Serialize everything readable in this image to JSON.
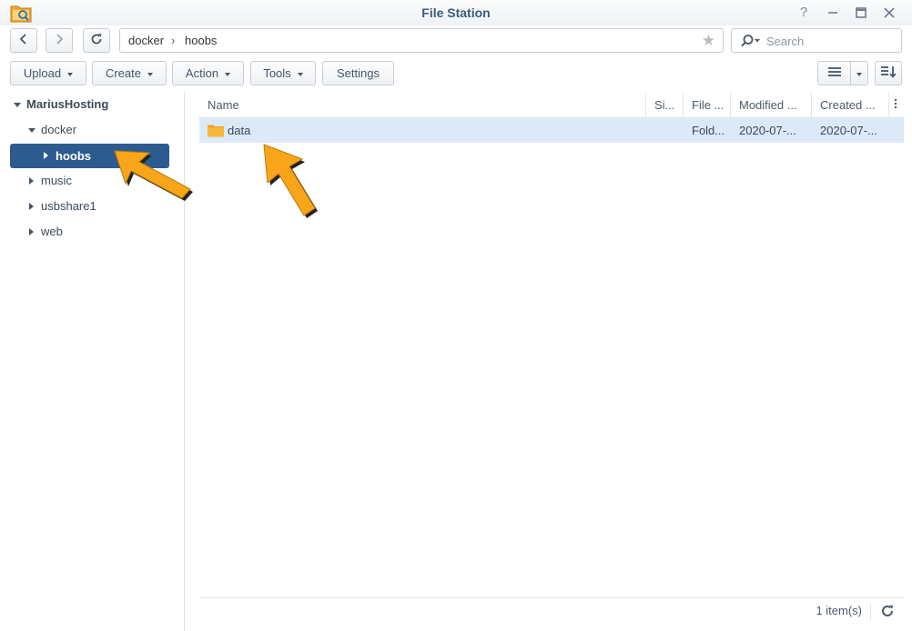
{
  "window": {
    "title": "File Station"
  },
  "nav": {
    "path": [
      "docker",
      "hoobs"
    ],
    "path_separator": "›"
  },
  "search": {
    "placeholder": "Search"
  },
  "toolbar": {
    "upload": "Upload",
    "create": "Create",
    "action": "Action",
    "tools": "Tools",
    "settings": "Settings"
  },
  "tree": {
    "root": "MariusHosting",
    "items": [
      {
        "label": "docker",
        "expanded": true
      },
      {
        "label": "hoobs",
        "selected": true
      },
      {
        "label": "music"
      },
      {
        "label": "usbshare1"
      },
      {
        "label": "web"
      }
    ]
  },
  "columns": [
    "Name",
    "Si...",
    "File ...",
    "Modified ...",
    "Created ..."
  ],
  "files": [
    {
      "name": "data",
      "size": "",
      "type": "Fold...",
      "modified": "2020-07-...",
      "created": "2020-07-..."
    }
  ],
  "footer": {
    "count": "1 item(s)"
  },
  "colors": {
    "accent": "#2e5b8f",
    "title": "#3b5a7e",
    "selected_row": "#dceaf8",
    "folder": "#f5a623",
    "arrow": "#f9a51a"
  },
  "icons": {
    "app": "file-station-icon",
    "back": "chevron-left-icon",
    "forward": "chevron-right-icon",
    "refresh": "refresh-icon",
    "star": "star-icon",
    "search": "search-icon",
    "list_view": "list-view-icon",
    "sort": "sort-icon",
    "folder": "folder-icon"
  }
}
